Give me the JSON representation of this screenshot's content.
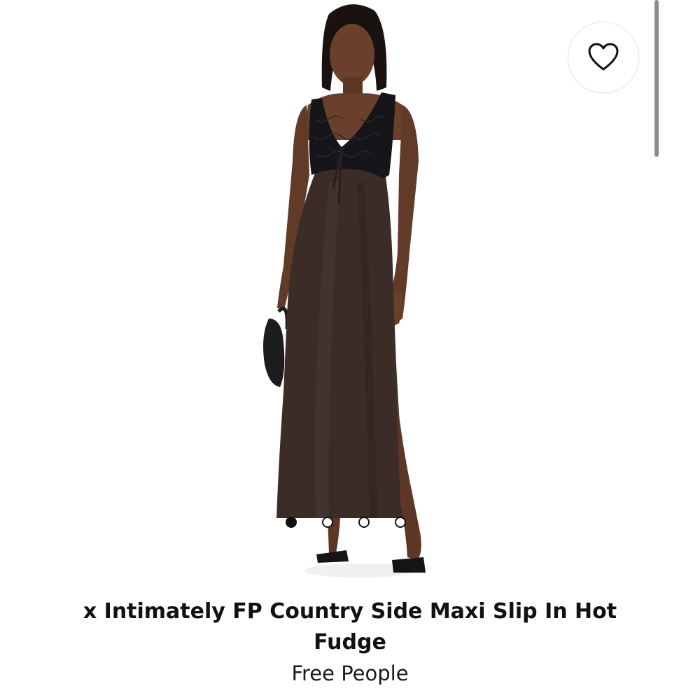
{
  "product": {
    "title": "x Intimately FP Country Side Maxi Slip In Hot Fudge",
    "brand": "Free People",
    "image_alt": "Model wearing brown satin maxi slip dress with black lace bodice"
  },
  "gallery": {
    "image_count": 4,
    "active_index": 0
  },
  "icons": {
    "favorite": "heart-outline-icon"
  },
  "colors": {
    "text": "#111111",
    "dress": "#3b2c28",
    "lace": "#15151a",
    "skin": "#6a3f2c",
    "background": "#ffffff"
  }
}
